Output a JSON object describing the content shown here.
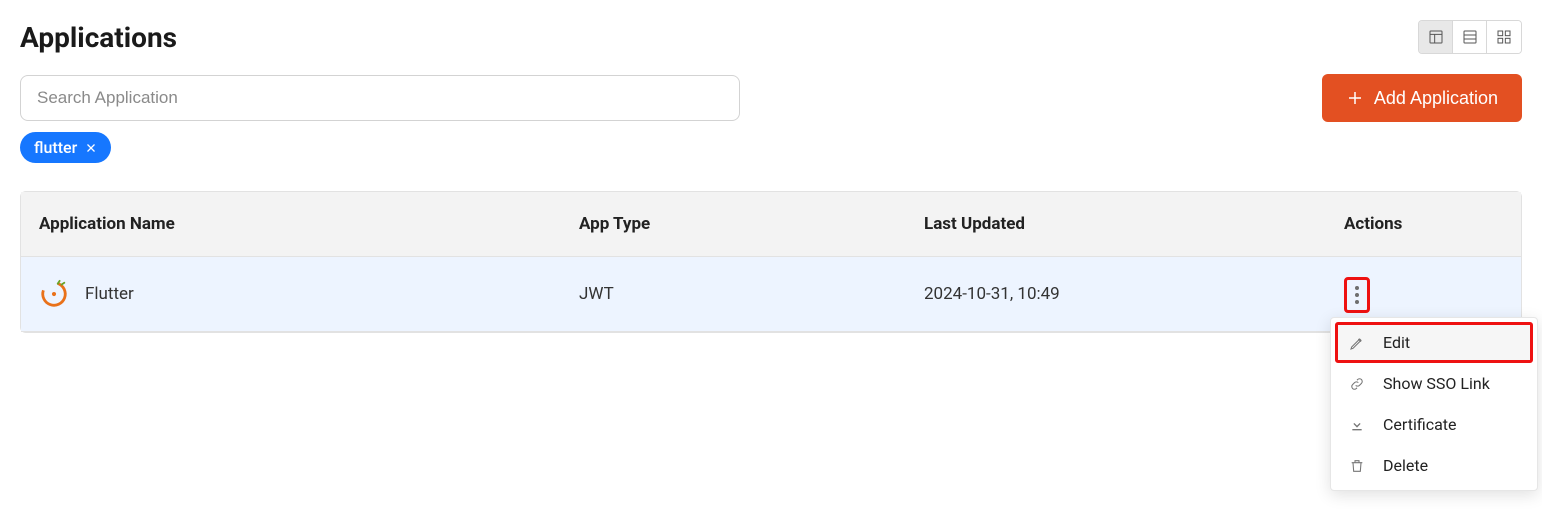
{
  "page": {
    "title": "Applications"
  },
  "search": {
    "placeholder": "Search Application",
    "value": ""
  },
  "filter_chips": [
    {
      "label": "flutter"
    }
  ],
  "actions": {
    "add_label": "Add Application"
  },
  "table": {
    "columns": {
      "name": "Application Name",
      "type": "App Type",
      "updated": "Last Updated",
      "actions": "Actions"
    },
    "rows": [
      {
        "name": "Flutter",
        "type": "JWT",
        "updated": "2024-10-31, 10:49"
      }
    ]
  },
  "row_menu": {
    "items": [
      {
        "icon": "pencil-icon",
        "label": "Edit",
        "highlighted": true
      },
      {
        "icon": "link-icon",
        "label": "Show SSO Link",
        "highlighted": false
      },
      {
        "icon": "download-icon",
        "label": "Certificate",
        "highlighted": false
      },
      {
        "icon": "trash-icon",
        "label": "Delete",
        "highlighted": false
      }
    ]
  }
}
